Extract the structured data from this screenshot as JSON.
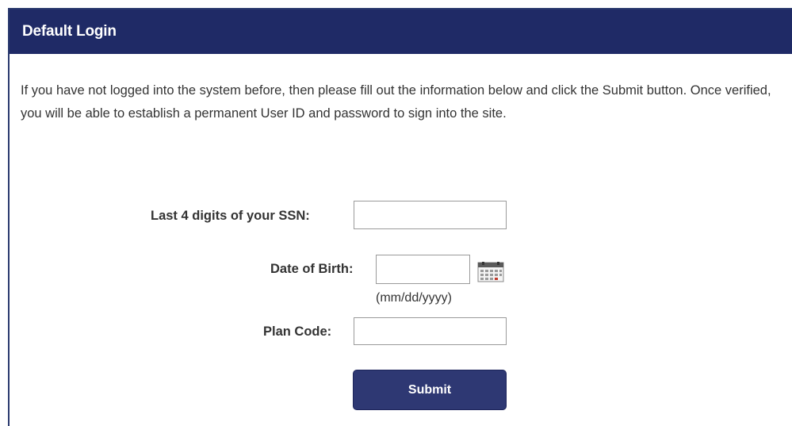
{
  "header": {
    "title": "Default Login"
  },
  "intro_text": "If you have not logged into the system before, then please fill out the information below and click the Submit button. Once verified, you will be able to establish a permanent User ID and password to sign into the site.",
  "form": {
    "ssn": {
      "label": "Last 4 digits of your SSN:",
      "value": ""
    },
    "dob": {
      "label": "Date of Birth:",
      "value": "",
      "hint": "(mm/dd/yyyy)",
      "icon": "calendar-icon"
    },
    "plan_code": {
      "label": "Plan Code:",
      "value": ""
    },
    "submit_label": "Submit"
  },
  "colors": {
    "header_bg": "#1f2a66",
    "button_bg": "#2e3873",
    "text": "#333333"
  }
}
